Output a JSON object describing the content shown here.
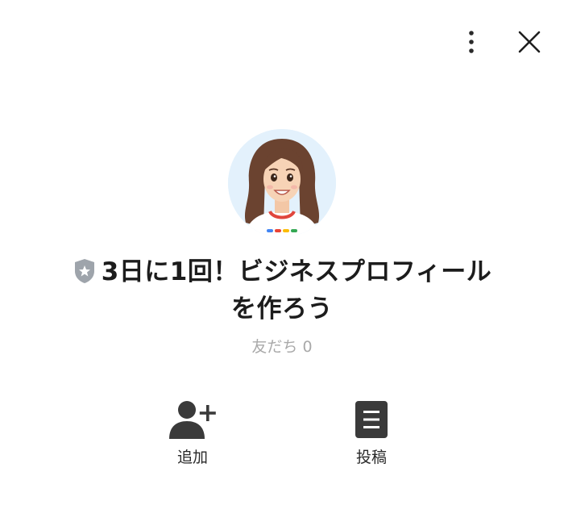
{
  "header": {
    "more_icon": "vertical-ellipsis-icon",
    "close_icon": "close-icon"
  },
  "profile": {
    "avatar_alt": "avatar",
    "badge_icon": "shield-star-icon",
    "badge_color": "#9ea4ab",
    "name": "3日に1回！ビジネスプロフィールを作ろう",
    "friends_text": "友だち 0"
  },
  "actions": {
    "add_label": "追加",
    "add_icon": "add-friend-icon",
    "post_label": "投稿",
    "post_icon": "post-icon"
  },
  "colors": {
    "text": "#1c1c1c",
    "muted": "#a9a9a9",
    "icon": "#3a3a3a",
    "avatar_bg": "#e3f1fc"
  }
}
